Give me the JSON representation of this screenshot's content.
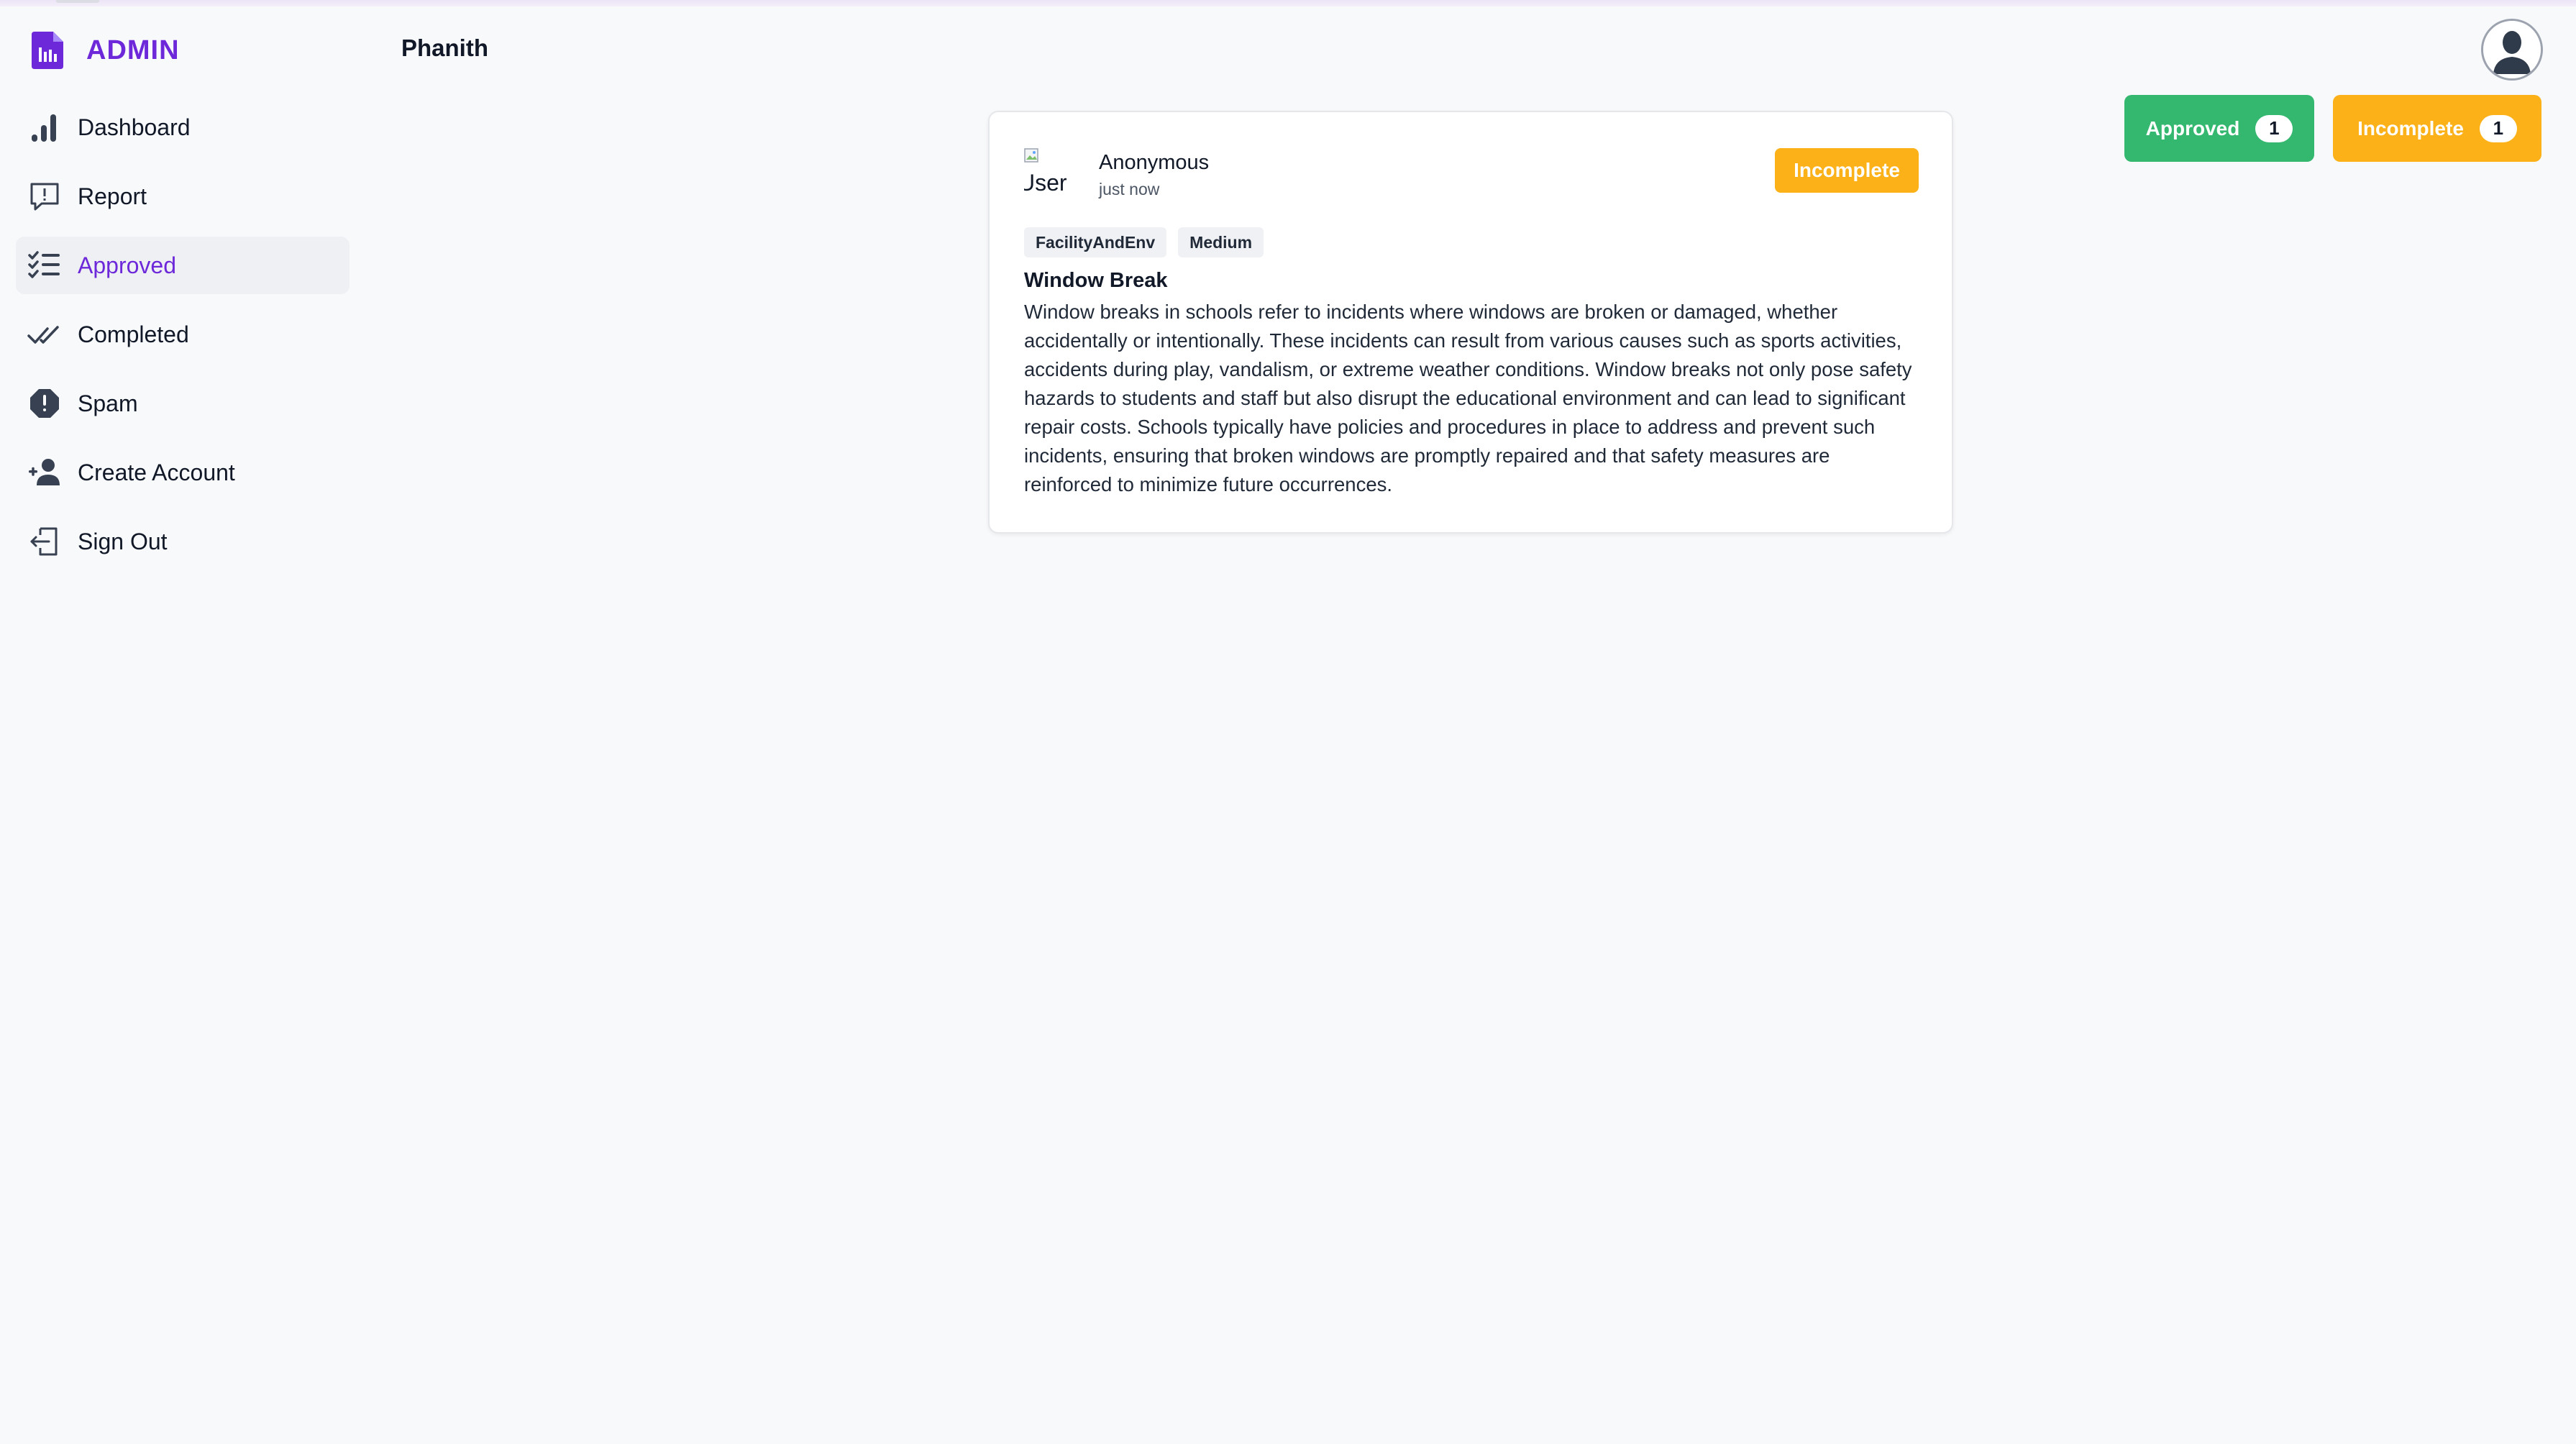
{
  "brand": {
    "title": "ADMIN",
    "icon": "report-document-icon",
    "accent": "#6d28d9"
  },
  "user": {
    "name": "Phanith",
    "avatar_icon": "user-avatar-icon"
  },
  "sidebar": {
    "items": [
      {
        "label": "Dashboard",
        "icon": "bar-chart-icon",
        "active": false
      },
      {
        "label": "Report",
        "icon": "message-alert-icon",
        "active": false
      },
      {
        "label": "Approved",
        "icon": "checklist-icon",
        "active": true
      },
      {
        "label": "Completed",
        "icon": "double-check-icon",
        "active": false
      },
      {
        "label": "Spam",
        "icon": "alert-octagon-icon",
        "active": false
      },
      {
        "label": "Create Account",
        "icon": "user-plus-icon",
        "active": false
      },
      {
        "label": "Sign Out",
        "icon": "sign-out-icon",
        "active": false
      }
    ]
  },
  "filters": {
    "approved": {
      "label": "Approved",
      "count": "1",
      "color": "#34b86f"
    },
    "incomplete": {
      "label": "Incomplete",
      "count": "1",
      "color": "#fbb117"
    }
  },
  "post": {
    "user_image_alt": "User",
    "author": "Anonymous",
    "time": "just now",
    "status": "Incomplete",
    "status_color": "#fbb117",
    "tags": [
      "FacilityAndEnv",
      "Medium"
    ],
    "title": "Window Break",
    "body": "Window breaks in schools refer to incidents where windows are broken or damaged, whether accidentally or intentionally. These incidents can result from various causes such as sports activities, accidents during play, vandalism, or extreme weather conditions. Window breaks not only pose safety hazards to students and staff but also disrupt the educational environment and can lead to significant repair costs. Schools typically have policies and procedures in place to address and prevent such incidents, ensuring that broken windows are promptly repaired and that safety measures are reinforced to minimize future occurrences."
  }
}
